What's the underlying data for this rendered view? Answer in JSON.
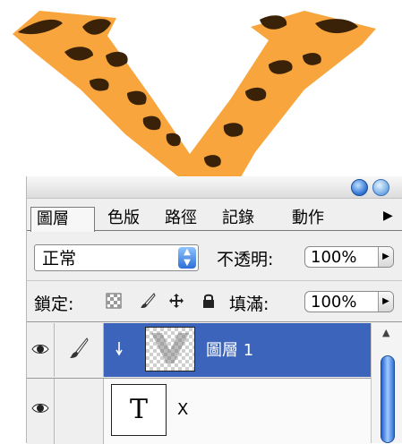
{
  "colors": {
    "tiger_orange": "#f7a53c",
    "tiger_stripe": "#3a2208",
    "selection": "#3b64ba",
    "accent_blue": "#2d6fd6"
  },
  "canvas": {
    "letter": "V"
  },
  "panel": {
    "tabs": [
      "圖層",
      "色版",
      "路徑",
      "記錄",
      "動作"
    ],
    "blend_mode": "正常",
    "opacity_label": "不透明:",
    "opacity_value": "100%",
    "lock_label": "鎖定:",
    "fill_label": "填滿:",
    "fill_value": "100%",
    "layers": [
      {
        "name": "圖層 1",
        "selected": true
      },
      {
        "name": "X",
        "type_icon": "T",
        "selected": false
      }
    ]
  }
}
